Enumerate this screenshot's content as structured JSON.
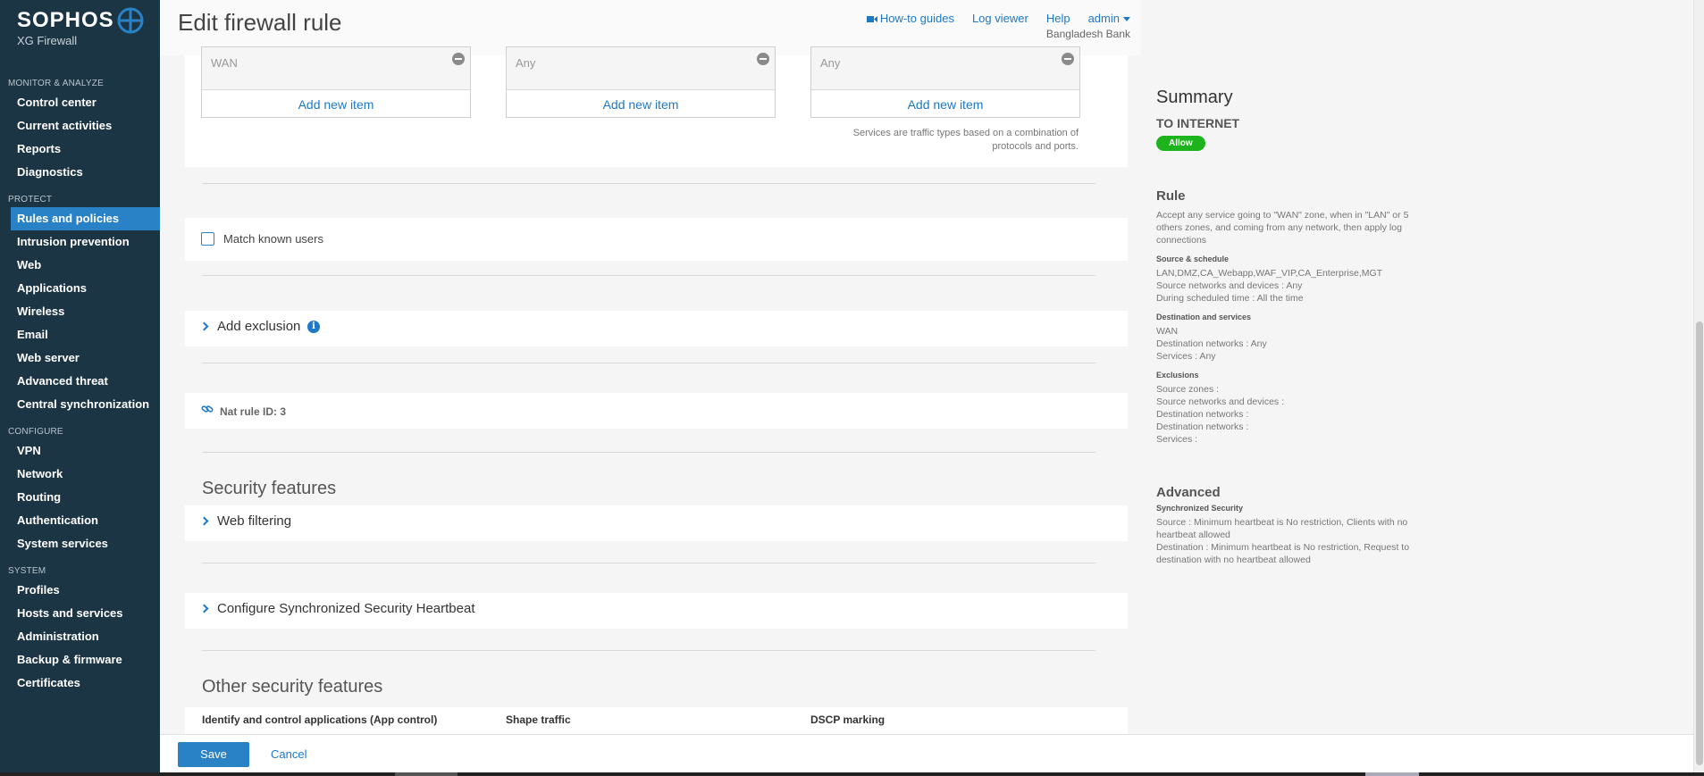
{
  "brand": {
    "name": "SOPHOS",
    "product": "XG Firewall"
  },
  "header": {
    "title": "Edit firewall rule",
    "links": {
      "howto": "How-to guides",
      "logviewer": "Log viewer",
      "help": "Help",
      "admin": "admin"
    },
    "org": "Bangladesh Bank"
  },
  "sidebar": {
    "sections": [
      {
        "title": "MONITOR & ANALYZE",
        "items": [
          "Control center",
          "Current activities",
          "Reports",
          "Diagnostics"
        ]
      },
      {
        "title": "PROTECT",
        "items": [
          "Rules and policies",
          "Intrusion prevention",
          "Web",
          "Applications",
          "Wireless",
          "Email",
          "Web server",
          "Advanced threat",
          "Central synchronization"
        ]
      },
      {
        "title": "CONFIGURE",
        "items": [
          "VPN",
          "Network",
          "Routing",
          "Authentication",
          "System services"
        ]
      },
      {
        "title": "SYSTEM",
        "items": [
          "Profiles",
          "Hosts and services",
          "Administration",
          "Backup & firmware",
          "Certificates"
        ]
      }
    ],
    "active": "Rules and policies"
  },
  "destination": {
    "zones_value": "WAN",
    "networks_value": "Any",
    "services_value": "Any",
    "add_new_item": "Add new item",
    "services_note_line1": "Services are traffic types based on a combination of",
    "services_note_line2": "protocols and ports."
  },
  "match_known_users": "Match known users",
  "add_exclusion": "Add exclusion",
  "nat_rule": "Nat rule ID: 3",
  "security_features": {
    "title": "Security features",
    "web_filtering": "Web filtering",
    "heartbeat": "Configure Synchronized Security Heartbeat"
  },
  "other_security": {
    "title": "Other security features",
    "app_control": "Identify and control applications (App control)",
    "shape_traffic": "Shape traffic",
    "dscp": "DSCP marking"
  },
  "footer": {
    "save": "Save",
    "cancel": "Cancel"
  },
  "summary": {
    "title": "Summary",
    "rule_name": "TO INTERNET",
    "action": "Allow",
    "rule_heading": "Rule",
    "rule_desc_1": "Accept any service going to \"WAN\" zone, when in \"LAN\" or 5",
    "rule_desc_2": "others zones, and coming from any network, then apply log",
    "rule_desc_3": "connections",
    "src_heading": "Source & schedule",
    "src_zones": "LAN,DMZ,CA_Webapp,WAF_VIP,CA_Enterprise,MGT",
    "src_networks": "Source networks and devices : Any",
    "src_schedule": "During scheduled time : All the time",
    "dst_heading": "Destination and services",
    "dst_zone": "WAN",
    "dst_networks": "Destination networks : Any",
    "dst_services": "Services : Any",
    "excl_heading": "Exclusions",
    "excl_src_zones": "Source zones :",
    "excl_src_networks": "Source networks and devices :",
    "excl_dst_networks_1": "Destination networks :",
    "excl_dst_networks_2": "Destination networks :",
    "excl_services": "Services :",
    "advanced_heading": "Advanced",
    "sync_heading": "Synchronized Security",
    "sync_src_1": "Source : Minimum heartbeat is No restriction, Clients with no",
    "sync_src_2": "heartbeat allowed",
    "sync_dst_1": "Destination : Minimum heartbeat is No restriction, Request to",
    "sync_dst_2": "destination with no heartbeat allowed"
  },
  "colors": {
    "sidebar_bg": "#1c3545",
    "accent": "#2a82c6",
    "allow": "#1db31d"
  }
}
